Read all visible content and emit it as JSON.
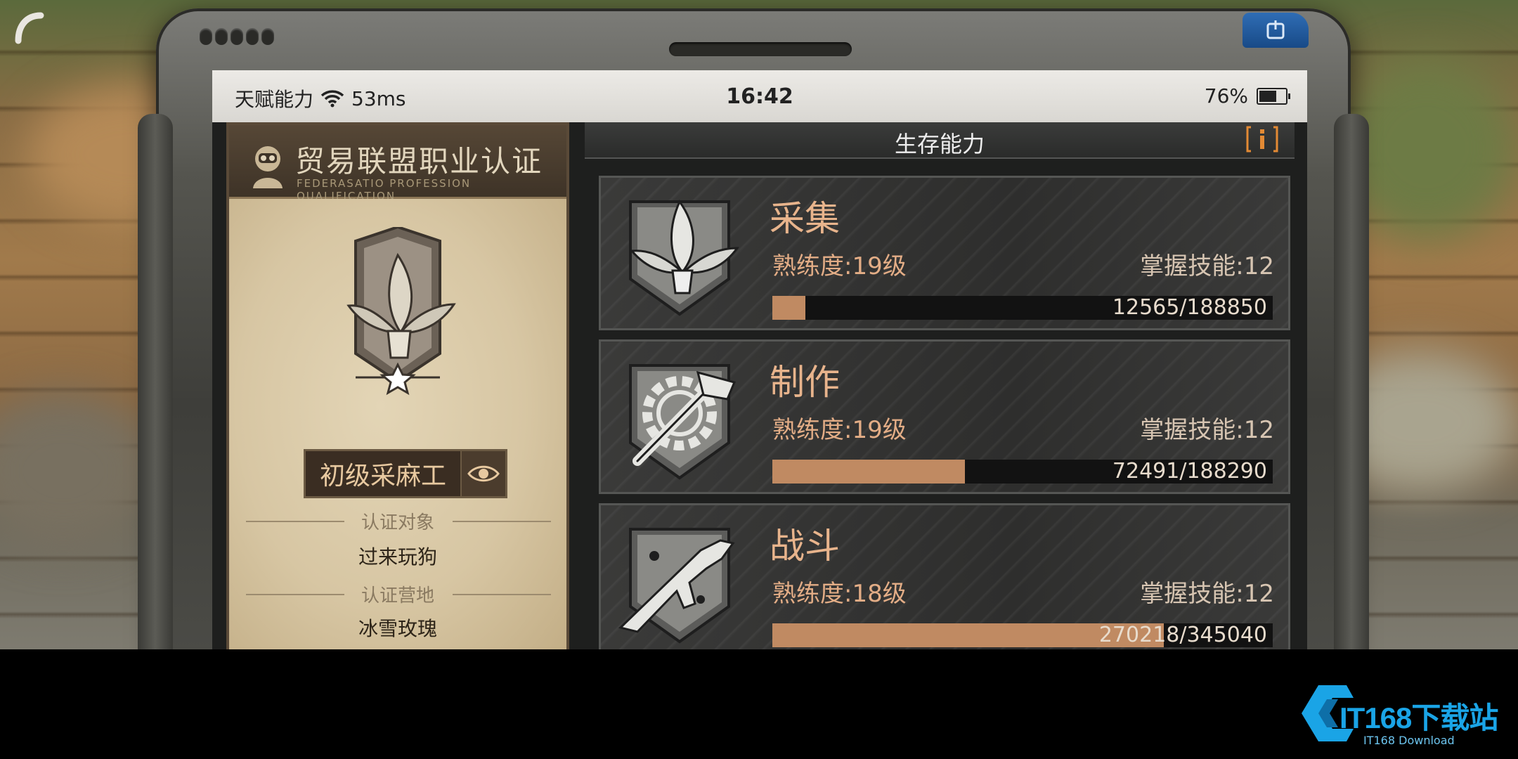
{
  "status_bar": {
    "carrier": "天赋能力",
    "ping": "53ms",
    "time": "16:42",
    "battery_percent": "76%",
    "battery_level": 0.76
  },
  "certificate": {
    "title": "贸易联盟职业认证",
    "subtitle": "FEDERASATIO PROFESSION QUALIFICATION",
    "rank": "初级采麻工",
    "cert_target_label": "认证对象",
    "cert_target_value": "过来玩狗",
    "cert_camp_label": "认证营地",
    "cert_camp_value": "冰雪玫瑰"
  },
  "panel": {
    "title": "生存能力",
    "info_icon": "info-icon"
  },
  "skills": [
    {
      "name": "采集",
      "proficiency": "熟练度:19级",
      "skills_count": "掌握技能:12",
      "progress_text": "12565/188850",
      "progress": 0.0665,
      "icon": "leaf-bundle-icon"
    },
    {
      "name": "制作",
      "proficiency": "熟练度:19级",
      "skills_count": "掌握技能:12",
      "progress_text": "72491/188290",
      "progress": 0.385,
      "icon": "gear-hammer-icon"
    },
    {
      "name": "战斗",
      "proficiency": "熟练度:18级",
      "skills_count": "掌握技能:12",
      "progress_text": "270218/345040",
      "progress": 0.783,
      "icon": "submachine-gun-icon"
    }
  ],
  "watermark": {
    "brand": "IT168下载站",
    "sub": "IT168 Download"
  },
  "colors": {
    "accent": "#e8b48c",
    "progress_fill": "#c08a62",
    "info_icon": "#e38a34",
    "watermark": "#1aa4e6"
  }
}
